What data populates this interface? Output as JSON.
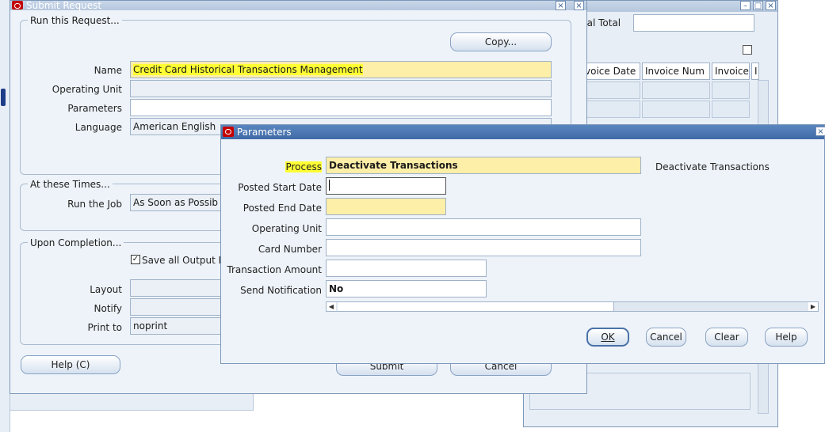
{
  "colors": {
    "title_active": "#3f6aa6",
    "required": "#fdeea8",
    "highlight": "#ffff33",
    "panel": "#eef3f9"
  },
  "background_form": {
    "actual_total_label": "ual Total",
    "columns": [
      "voice Date",
      "Invoice Num",
      "Invoice",
      "I"
    ]
  },
  "submit_request": {
    "title": "Submit Request",
    "run_group": "Run this Request...",
    "copy_button": "Copy...",
    "name_label": "Name",
    "name_value": "Credit Card Historical Transactions Management",
    "operating_unit_label": "Operating Unit",
    "parameters_label": "Parameters",
    "language_label": "Language",
    "language_value": "American English",
    "times_group": "At these Times...",
    "run_job_label": "Run the Job",
    "run_job_value": "As Soon as Possib",
    "completion_group": "Upon Completion...",
    "save_output_label": "Save all Output F",
    "layout_label": "Layout",
    "notify_label": "Notify",
    "print_to_label": "Print to",
    "print_to_value": "noprint",
    "help_button": "Help (C)",
    "submit_button": "Submit",
    "cancel_button": "Cancel"
  },
  "parameters": {
    "title": "Parameters",
    "process_label": "Process",
    "process_value": "Deactivate Transactions",
    "process_description": "Deactivate Transactions",
    "posted_start_label": "Posted Start Date",
    "posted_end_label": "Posted End Date",
    "operating_unit_label": "Operating Unit",
    "card_number_label": "Card Number",
    "transaction_amount_label": "Transaction Amount",
    "send_notification_label": "Send Notification",
    "send_notification_value": "No",
    "ok_button": "OK",
    "cancel_button": "Cancel",
    "clear_button": "Clear",
    "help_button": "Help"
  },
  "icons": [
    "oracle-logo-icon",
    "close-icon",
    "minimize-icon",
    "maximize-icon",
    "checkbox-checked-icon",
    "scroll-left-icon",
    "scroll-right-icon"
  ]
}
